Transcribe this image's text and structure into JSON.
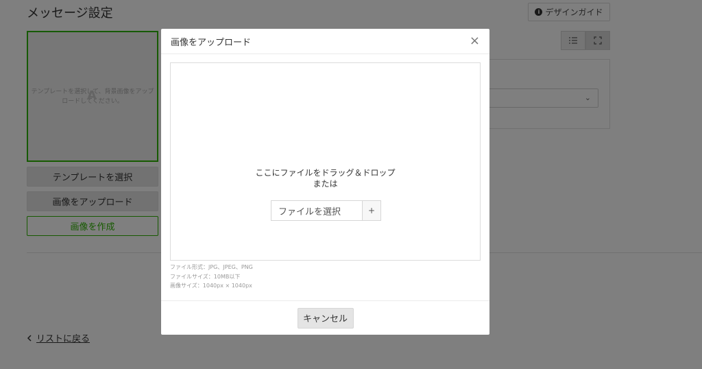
{
  "page": {
    "title": "メッセージ設定",
    "design_guide_label": "デザインガイド",
    "preview_hint_line1": "テンプレートを選択して、背景画像をアップ",
    "preview_hint_line2": "ロードしてください。",
    "preview_letter": "A",
    "select_template_label": "テンプレートを選択",
    "upload_image_label": "画像をアップロード",
    "create_image_label": "画像を作成",
    "back_link_label": "リストに戻る"
  },
  "modal": {
    "title": "画像をアップロード",
    "close_glyph": "×",
    "drop_text": "ここにファイルをドラッグ＆ドロップ",
    "or_text": "または",
    "file_select_label": "ファイルを選択",
    "plus_label": "+",
    "notes": [
      "ファイル形式：JPG、JPEG、PNG",
      "ファイルサイズ：10MB以下",
      "画像サイズ：1040px × 1040px"
    ],
    "cancel_label": "キャンセル"
  },
  "colors": {
    "accent_green": "#2db400",
    "overlay": "rgba(0,0,0,0.5)"
  }
}
